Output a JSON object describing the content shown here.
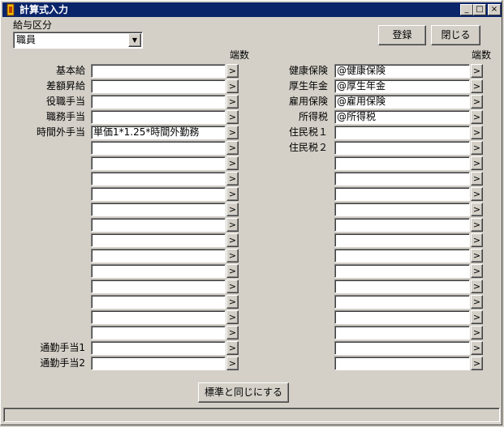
{
  "window": {
    "title": "計算式入力",
    "minimize_glyph": "_",
    "maximize_glyph": "□",
    "close_glyph": "×"
  },
  "salary_category": {
    "label": "給与区分",
    "value": "職員",
    "dropdown_glyph": "▼"
  },
  "buttons": {
    "register": "登録",
    "close": "閉じる",
    "same_as_standard": "標準と同じにする"
  },
  "rounding_header": "端数",
  "arrow_glyph": ">",
  "left_rows": [
    {
      "label": "基本給",
      "value": ""
    },
    {
      "label": "差額昇給",
      "value": ""
    },
    {
      "label": "役職手当",
      "value": ""
    },
    {
      "label": "職務手当",
      "value": ""
    },
    {
      "label": "時間外手当",
      "value": "単価1*1.25*時間外勤務"
    },
    {
      "label": "",
      "value": ""
    },
    {
      "label": "",
      "value": ""
    },
    {
      "label": "",
      "value": ""
    },
    {
      "label": "",
      "value": ""
    },
    {
      "label": "",
      "value": ""
    },
    {
      "label": "",
      "value": ""
    },
    {
      "label": "",
      "value": ""
    },
    {
      "label": "",
      "value": ""
    },
    {
      "label": "",
      "value": ""
    },
    {
      "label": "",
      "value": ""
    },
    {
      "label": "",
      "value": ""
    },
    {
      "label": "",
      "value": ""
    },
    {
      "label": "",
      "value": ""
    },
    {
      "label": "通勤手当1",
      "value": ""
    },
    {
      "label": "通勤手当2",
      "value": ""
    }
  ],
  "right_rows": [
    {
      "label": "健康保険",
      "value": "@健康保険"
    },
    {
      "label": "厚生年金",
      "value": "@厚生年金"
    },
    {
      "label": "雇用保険",
      "value": "@雇用保険"
    },
    {
      "label": "所得税",
      "value": "@所得税"
    },
    {
      "label": "住民税１",
      "value": ""
    },
    {
      "label": "住民税２",
      "value": ""
    },
    {
      "label": "",
      "value": ""
    },
    {
      "label": "",
      "value": ""
    },
    {
      "label": "",
      "value": ""
    },
    {
      "label": "",
      "value": ""
    },
    {
      "label": "",
      "value": ""
    },
    {
      "label": "",
      "value": ""
    },
    {
      "label": "",
      "value": ""
    },
    {
      "label": "",
      "value": ""
    },
    {
      "label": "",
      "value": ""
    },
    {
      "label": "",
      "value": ""
    },
    {
      "label": "",
      "value": ""
    },
    {
      "label": "",
      "value": ""
    },
    {
      "label": "",
      "value": ""
    },
    {
      "label": "",
      "value": ""
    }
  ],
  "status_text": ""
}
